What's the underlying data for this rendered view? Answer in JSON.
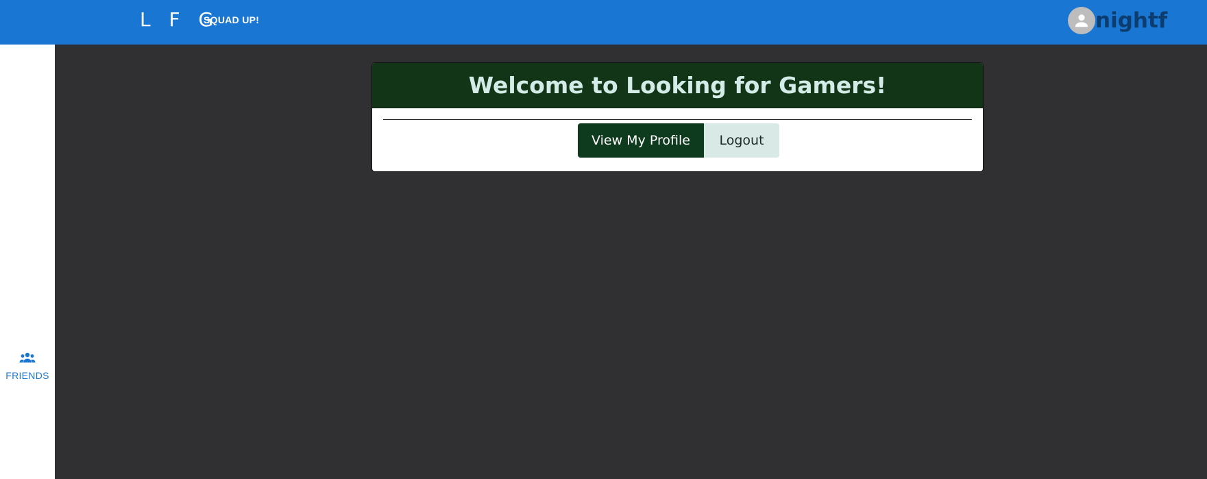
{
  "header": {
    "logo": "L F G",
    "tagline": "SQUAD UP!",
    "username": "nightf",
    "avatar_icon": "account-circle-icon",
    "bar_color": "#1976d2"
  },
  "sidebar": {
    "items": [
      {
        "label": "FRIENDS",
        "icon": "group-icon"
      }
    ]
  },
  "card": {
    "title": "Welcome to Looking for Gamers!",
    "buttons": {
      "profile": "View My Profile",
      "logout": "Logout"
    },
    "header_color": "#133517"
  }
}
